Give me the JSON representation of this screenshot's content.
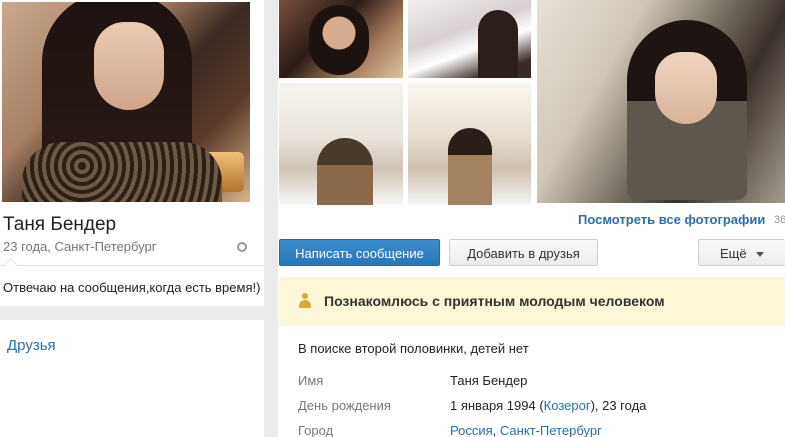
{
  "profile": {
    "name": "Таня Бендер",
    "age_city": "23 года, Санкт-Петербург",
    "status": "Отвечаю на сообщения,когда есть время!)"
  },
  "friends": {
    "title": "Друзья"
  },
  "photos": {
    "view_all": "Посмотреть все фотографии",
    "count": "36"
  },
  "actions": {
    "message": "Написать сообщение",
    "add_friend": "Добавить в друзья",
    "more": "Ещё"
  },
  "banner": {
    "text": "Познакомлюсь с приятным молодым человеком"
  },
  "about": {
    "search": "В поиске второй половинки, детей нет",
    "rows": {
      "name_label": "Имя",
      "name_value": "Таня Бендер",
      "birthday_label": "День рождения",
      "birthday_date": "1 января 1994 (",
      "birthday_sign": "Козерог",
      "birthday_age": "), 23 года",
      "city_label": "Город",
      "city_country": "Россия",
      "city_sep": ", ",
      "city_name": "Санкт-Петербург"
    }
  },
  "colors": {
    "link": "#2a6fa8",
    "primary_button": "#2a75b6",
    "banner_bg": "#fdf6d7"
  },
  "icons": {
    "status_dot": "online-status-icon",
    "banner": "person-icon",
    "more": "chevron-down-icon"
  }
}
